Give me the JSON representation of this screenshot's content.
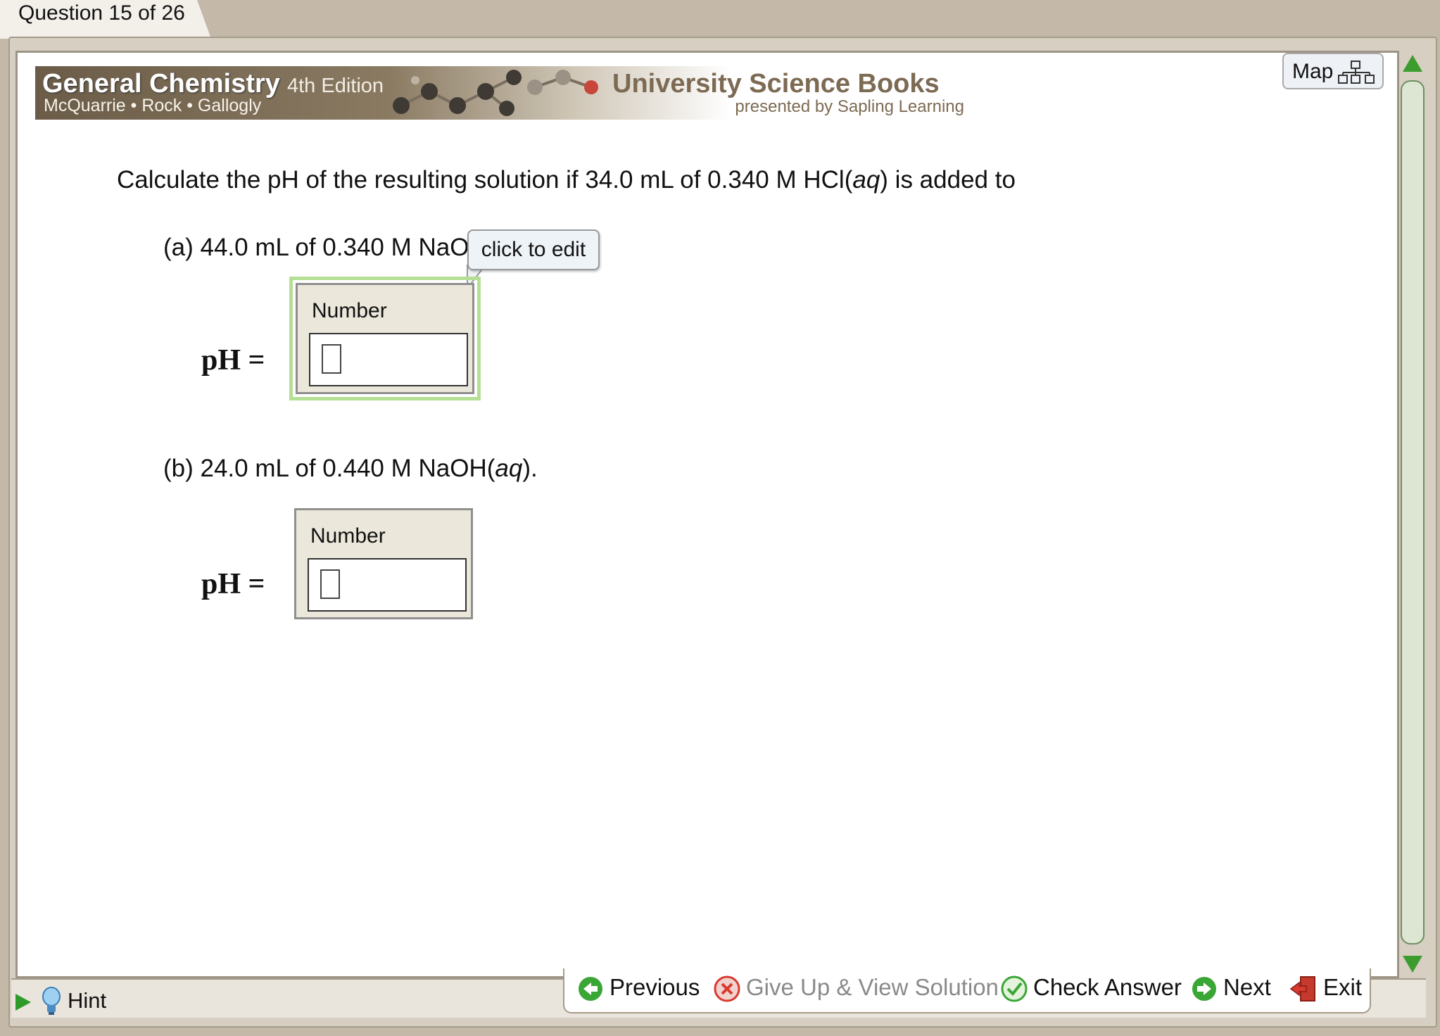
{
  "tab": {
    "label": "Question 15 of 26"
  },
  "banner": {
    "title": "General Chemistry",
    "edition": "4th Edition",
    "authors": "McQuarrie • Rock • Gallogly",
    "publisher": "University Science Books",
    "presented_by": "presented by Sapling Learning"
  },
  "map_button": {
    "label": "Map"
  },
  "question": {
    "prefix": "Calculate the pH of the resulting solution if 34.0 mL of 0.340 M HCl(",
    "italic": "aq",
    "suffix": ") is added to"
  },
  "part_a": {
    "text": "(a) 44.0 mL of 0.340 M NaO",
    "tooltip": "click to edit",
    "ph_label": "pH =",
    "box_label": "Number",
    "value": ""
  },
  "part_b": {
    "prefix": "(b) 24.0 mL of 0.440 M NaOH(",
    "italic": "aq",
    "suffix": ").",
    "ph_label": "pH =",
    "box_label": "Number",
    "value": ""
  },
  "hint": {
    "label": "Hint"
  },
  "nav": {
    "previous": "Previous",
    "give_up": "Give Up & View Solution",
    "check": "Check Answer",
    "next": "Next",
    "exit": "Exit"
  },
  "colors": {
    "green": "#3aa635",
    "red": "#d83a2e",
    "scroll_green": "#3d9c2e"
  }
}
